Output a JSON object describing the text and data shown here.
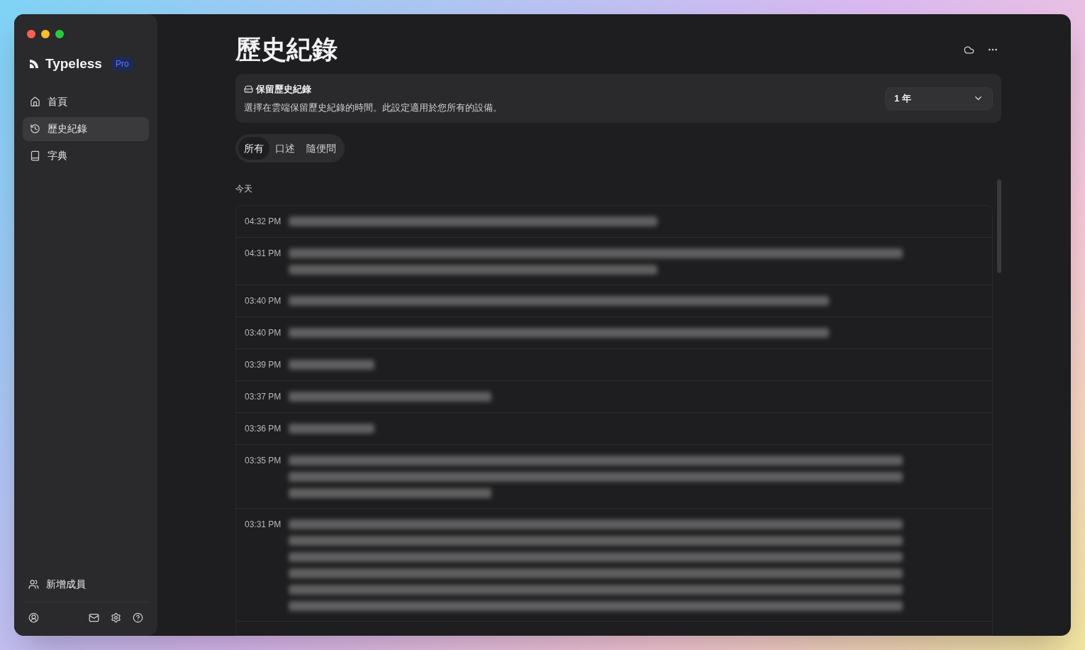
{
  "window": {
    "controls": [
      {
        "color": "#ff5f57"
      },
      {
        "color": "#febc2e"
      },
      {
        "color": "#28c840"
      }
    ]
  },
  "sidebar": {
    "app_name": "Typeless",
    "plan_badge": "Pro",
    "items": [
      {
        "kind": "home",
        "label": "首頁",
        "selected": false
      },
      {
        "kind": "history",
        "label": "歷史紀錄",
        "selected": true
      },
      {
        "kind": "dictionary",
        "label": "字典",
        "selected": false
      }
    ],
    "add_member": "新增成員"
  },
  "page": {
    "title": "歷史紀錄",
    "retention": {
      "title": "保留歷史紀錄",
      "description": "選擇在雲端保留歷史紀錄的時間。此設定適用於您所有的設備。",
      "value": "1 年"
    },
    "tabs": [
      {
        "label": "所有",
        "selected": true
      },
      {
        "label": "口述",
        "selected": false
      },
      {
        "label": "隨便問",
        "selected": false
      }
    ],
    "group_label": "今天",
    "entries": [
      {
        "time": "04:32 PM",
        "blurred_lines": [
          {
            "kind": "medium"
          }
        ]
      },
      {
        "time": "04:31 PM",
        "blurred_lines": [
          {
            "kind": "full"
          },
          {
            "kind": "medium"
          }
        ]
      },
      {
        "time": "03:40 PM",
        "blurred_lines": [
          {
            "kind": "long"
          }
        ]
      },
      {
        "time": "03:40 PM",
        "blurred_lines": [
          {
            "kind": "long"
          }
        ]
      },
      {
        "time": "03:39 PM",
        "blurred_lines": [
          {
            "kind": "short"
          }
        ]
      },
      {
        "time": "03:37 PM",
        "blurred_lines": [
          {
            "kind": "third"
          }
        ]
      },
      {
        "time": "03:36 PM",
        "blurred_lines": [
          {
            "kind": "short"
          }
        ]
      },
      {
        "time": "03:35 PM",
        "blurred_lines": [
          {
            "kind": "full"
          },
          {
            "kind": "full"
          },
          {
            "kind": "third"
          }
        ]
      },
      {
        "time": "03:31 PM",
        "blurred_lines": [
          {
            "kind": "full"
          },
          {
            "kind": "full"
          },
          {
            "kind": "full"
          },
          {
            "kind": "full"
          },
          {
            "kind": "full"
          },
          {
            "kind": "full"
          }
        ]
      }
    ]
  }
}
